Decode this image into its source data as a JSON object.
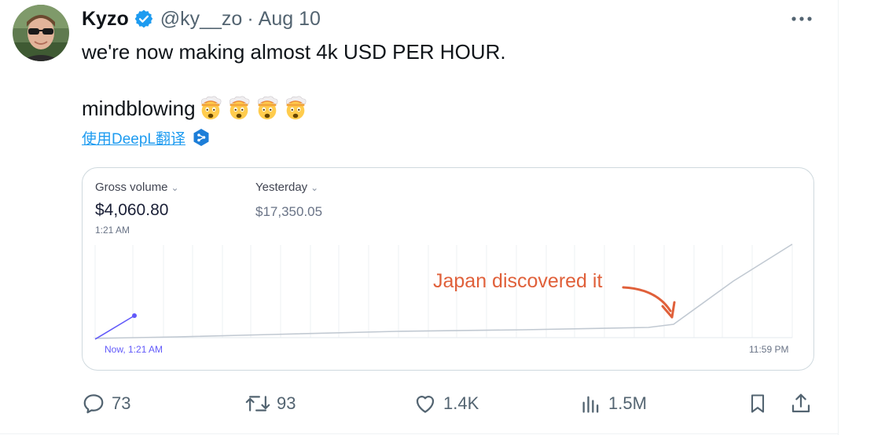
{
  "tweet": {
    "author_name": "Kyzo",
    "handle": "@ky__zo",
    "separator": "·",
    "date": "Aug 10",
    "line1": "we're now making almost 4k USD PER HOUR.",
    "line2": "mindblowing",
    "emojis": [
      "exploding-head-emoji",
      "exploding-head-emoji",
      "exploding-head-emoji",
      "exploding-head-emoji"
    ],
    "translate_label": "使用DeepL翻译"
  },
  "card": {
    "metric1_label": "Gross volume",
    "metric1_value": "$4,060.80",
    "metric1_time": "1:21 AM",
    "metric2_label": "Yesterday",
    "metric2_value": "$17,350.05",
    "axis_start": "Now, 1:21 AM",
    "axis_end": "11:59 PM",
    "annotation": "Japan discovered it",
    "colors": {
      "today": "#625afa",
      "yesterday": "#c1c9d2",
      "annotation": "#e0603a"
    }
  },
  "actions": {
    "reply_count": "73",
    "retweet_count": "93",
    "like_count": "1.4K",
    "views_count": "1.5M"
  },
  "icons": [
    "verified-badge-icon",
    "more-icon",
    "deepl-icon",
    "reply-icon",
    "retweet-icon",
    "like-icon",
    "views-icon",
    "bookmark-icon",
    "share-icon"
  ]
}
